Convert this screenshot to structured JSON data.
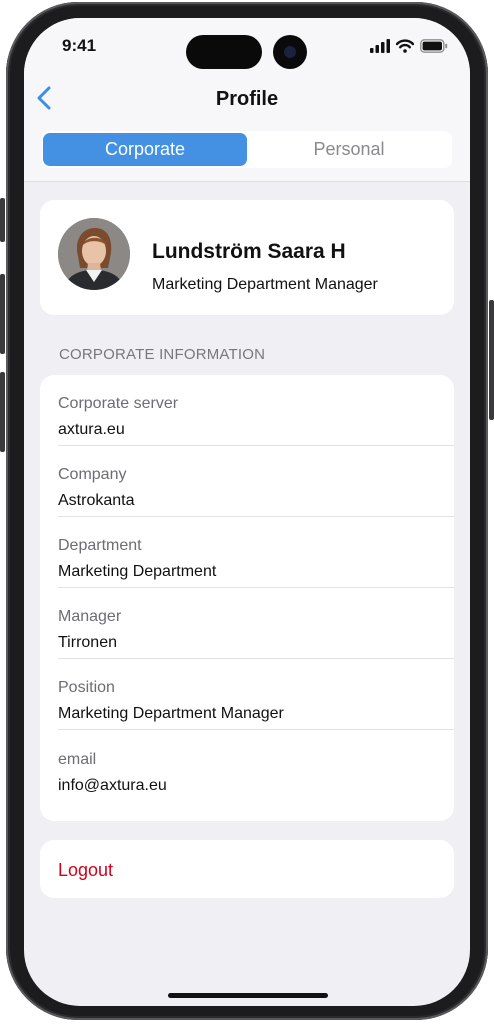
{
  "status_bar": {
    "time": "9:41"
  },
  "nav": {
    "back_icon": "chevron-left-icon",
    "title": "Profile"
  },
  "segmented": {
    "tabs": [
      {
        "label": "Corporate",
        "selected": true
      },
      {
        "label": "Personal",
        "selected": false
      }
    ]
  },
  "profile": {
    "name": "Lundström Saara H",
    "role": "Marketing Department Manager"
  },
  "section_title": "CORPORATE INFORMATION",
  "fields": [
    {
      "label": "Corporate server",
      "value": "axtura.eu"
    },
    {
      "label": "Company",
      "value": "Astrokanta"
    },
    {
      "label": "Department",
      "value": "Marketing Department"
    },
    {
      "label": "Manager",
      "value": "Tirronen"
    },
    {
      "label": "Position",
      "value": "Marketing Department Manager"
    },
    {
      "label": "email",
      "value": "info@axtura.eu"
    }
  ],
  "logout_label": "Logout",
  "colors": {
    "accent": "#4491e3",
    "destructive": "#d0021b",
    "background": "#efeff4"
  }
}
